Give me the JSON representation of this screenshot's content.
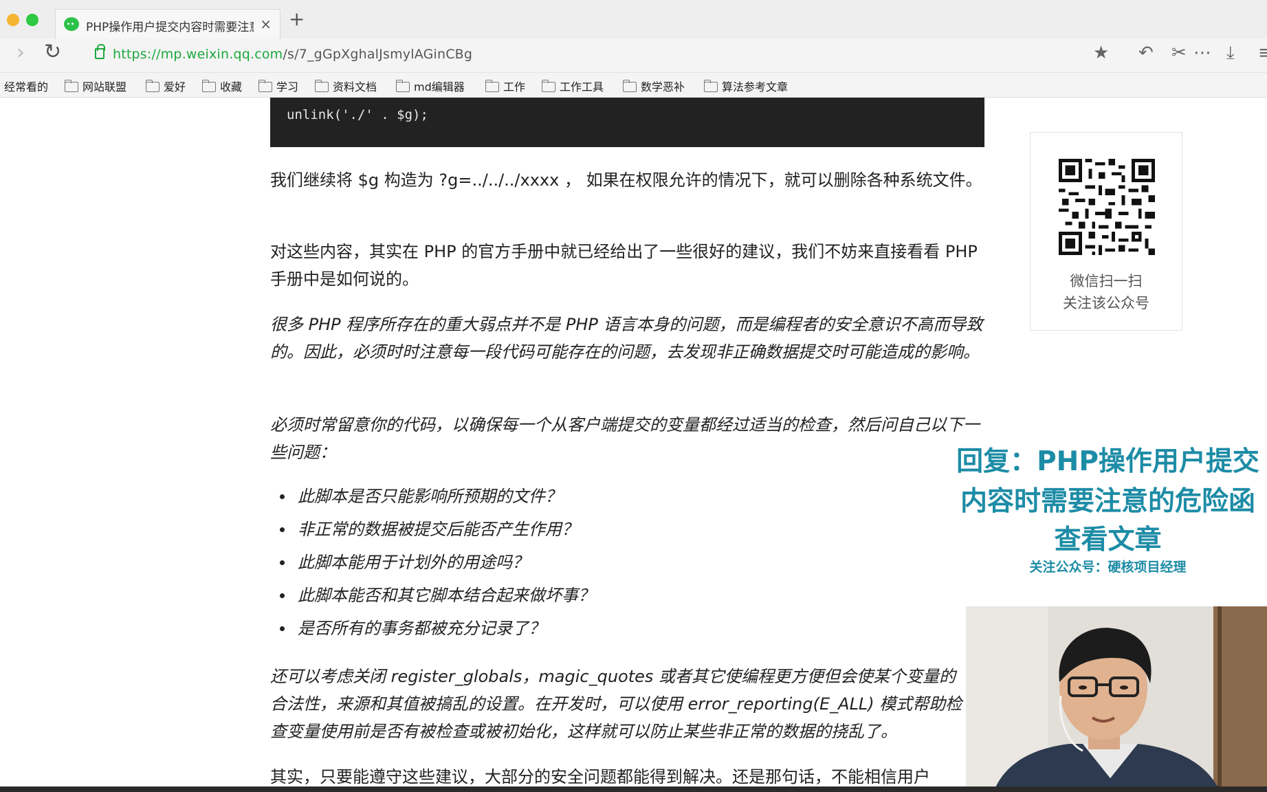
{
  "browser": {
    "tab_title": "PHP操作用户提交内容时需要注意的危险函数",
    "tab_close": "×",
    "new_tab": "+",
    "url_scheme": "https://",
    "url_host": "mp.weixin.qq.com",
    "url_path": "/s/7_gGpXghalJsmylAGinCBg",
    "bookmarks": [
      "经常看的",
      "网站联盟",
      "爱好",
      "收藏",
      "学习",
      "资料文档",
      "md编辑器",
      "工作",
      "工作工具",
      "数学恶补",
      "算法参考文章"
    ]
  },
  "article": {
    "code": "unlink('./' . $g);",
    "p1": "我们继续将 $g 构造为 ?g=../../../xxxx ， 如果在权限允许的情况下，就可以删除各种系统文件。",
    "p2": "对这些内容，其实在 PHP 的官方手册中就已经给出了一些很好的建议，我们不妨来直接看看 PHP 手册中是如何说的。",
    "q1": "很多 PHP 程序所存在的重大弱点并不是 PHP 语言本身的问题，而是编程者的安全意识不高而导致的。因此，必须时时注意每一段代码可能存在的问题，去发现非正确数据提交时可能造成的影响。",
    "q2": "必须时常留意你的代码，以确保每一个从客户端提交的变量都经过适当的检查，然后问自己以下一些问题：",
    "bullets": [
      "此脚本是否只能影响所预期的文件？",
      "非正常的数据被提交后能否产生作用？",
      "此脚本能用于计划外的用途吗？",
      "此脚本能否和其它脚本结合起来做坏事？",
      "是否所有的事务都被充分记录了？"
    ],
    "q3": "还可以考虑关闭 register_globals，magic_quotes 或者其它使编程更方便但会使某个变量的合法性，来源和其值被搞乱的设置。在开发时，可以使用 error_reporting(E_ALL) 模式帮助检查变量使用前是否有被检查或被初始化，这样就可以防止某些非正常的数据的挠乱了。",
    "p3": "其实，只要能遵守这些建议，大部分的安全问题都能得到解决。还是那句话，不能相信用户"
  },
  "qr": {
    "caption_1": "微信扫一扫",
    "caption_2": "关注该公众号"
  },
  "overlay": {
    "line1": "回复：PHP操作用户提交",
    "line2": "内容时需要注意的危险函",
    "line3": "查看文章",
    "subtitle": "关注公众号：硬核项目经理"
  },
  "colors": {
    "url_green": "#1ba83c",
    "overlay_teal": "#1d8ca6",
    "code_bg": "#222222"
  }
}
